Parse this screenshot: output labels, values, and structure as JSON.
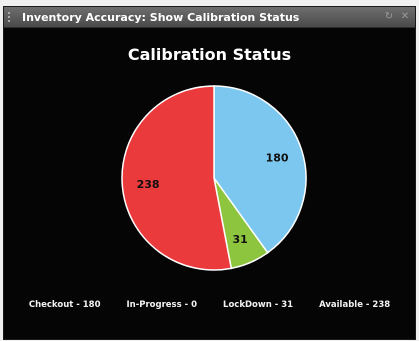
{
  "window": {
    "title": "Inventory Accuracy: Show Calibration Status"
  },
  "chart_data": {
    "type": "pie",
    "title": "Calibration Status",
    "slices": [
      {
        "label": "Checkout",
        "value": 180,
        "color": "#7cc7ef"
      },
      {
        "label": "In-Progress",
        "value": 0,
        "color": "#f0c040"
      },
      {
        "label": "LockDown",
        "value": 31,
        "color": "#8dc53e"
      },
      {
        "label": "Available",
        "value": 238,
        "color": "#ea3a3c"
      }
    ],
    "legend": [
      "Checkout - 180",
      "In-Progress - 0",
      "LockDown - 31",
      "Available - 238"
    ],
    "legend_position": "bottom"
  }
}
